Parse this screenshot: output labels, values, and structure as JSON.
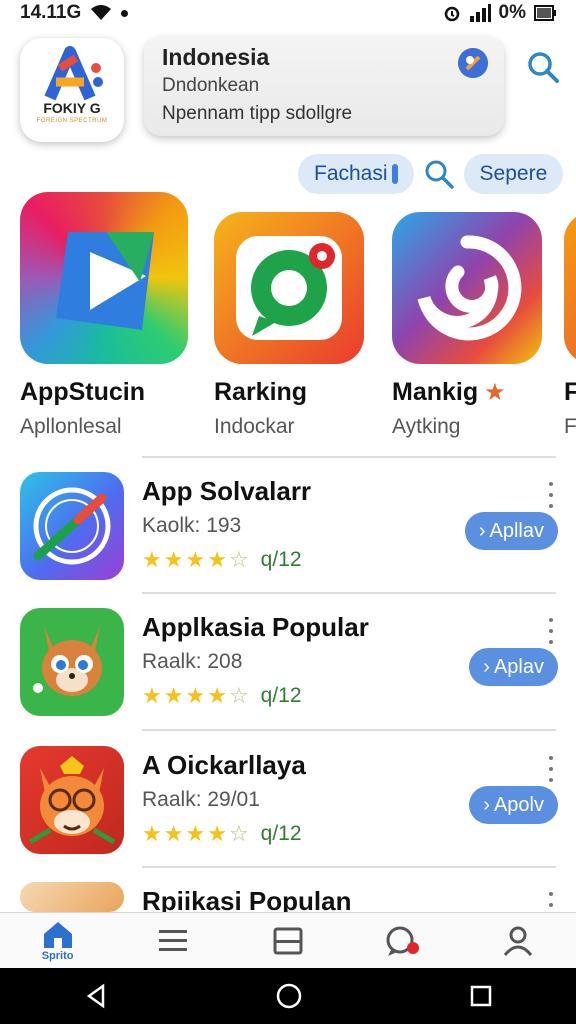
{
  "status_bar": {
    "time": "14.11G",
    "battery": "0%"
  },
  "header": {
    "logo_text": "FOKIY G",
    "logo_sub": "FOREIGN SPECTRUM",
    "search_title": "Indonesia",
    "search_subtitle": "Dndonkean",
    "search_placeholder": "Npennam tipp sdollgre"
  },
  "chips": {
    "chip1": "Fachasi",
    "chip2": "Sepere"
  },
  "featured": [
    {
      "name": "AppStucin",
      "sub": "Apllonlesal"
    },
    {
      "name": "Rarking",
      "sub": "Indockar"
    },
    {
      "name": "Mankig",
      "sub": "Aytking"
    },
    {
      "name": "F",
      "sub": "F"
    }
  ],
  "apps": [
    {
      "name": "App Solvalarr",
      "meta": "Kaolk: 193",
      "rating": "q/12",
      "button": "Apllav",
      "stars": 4
    },
    {
      "name": "Applkasia Popular",
      "meta": "Raalk: 208",
      "rating": "q/12",
      "button": "Aplav",
      "stars": 4
    },
    {
      "name": "A Oickarllaya",
      "meta": "Raalk: 29/01",
      "rating": "q/12",
      "button": "Apolv",
      "stars": 4
    },
    {
      "name": "Rpiikasi Populan",
      "meta": "",
      "rating": "",
      "button": "",
      "stars": 0
    }
  ],
  "bottom_nav": {
    "home_label": "Sprito"
  },
  "colors": {
    "accent": "#5b8fe0",
    "star": "#f4c21a",
    "rating_text": "#2f7d2f"
  }
}
